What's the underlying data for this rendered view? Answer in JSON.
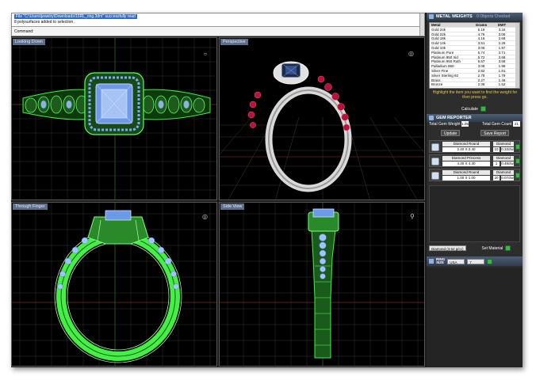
{
  "command": {
    "line1": "File \"C:\\Users\\jewelry\\Downloads\\16RL_ring.3dm\" successfully read",
    "line2": "8 polysurfaces added to selection.",
    "prompt": "Command:"
  },
  "viewports": {
    "top_left": "Looking Down",
    "top_right": "Perspective",
    "bottom_left": "Through Finger",
    "bottom_right": "Side View"
  },
  "metal_weights": {
    "title": "METAL WEIGHTS",
    "subtitle": "0 Objects Checked",
    "headers": [
      "Metal",
      "Grams",
      "DWT"
    ],
    "rows": [
      [
        "Gold 24k",
        "5.19",
        "3.34"
      ],
      [
        "Gold 22k",
        "4.76",
        "3.06"
      ],
      [
        "Gold 18k",
        "4.16",
        "2.68"
      ],
      [
        "Gold 14k",
        "3.51",
        "2.26"
      ],
      [
        "Gold 10k",
        "3.06",
        "1.97"
      ],
      [
        "Platinum Pure",
        "5.74",
        "3.71"
      ],
      [
        "Platinum 950 Irid",
        "5.72",
        "3.68"
      ],
      [
        "Platinum 950 Ruth",
        "5.57",
        "3.58"
      ],
      [
        "Palladium 950",
        "3.08",
        "1.98"
      ],
      [
        "Silver Fine",
        "2.82",
        "1.81"
      ],
      [
        "Silver Sterling 92",
        "2.78",
        "1.79"
      ],
      [
        "Brass",
        "2.27",
        "1.46"
      ],
      [
        "Bronze",
        "2.36",
        "1.52"
      ]
    ],
    "hint": "Highlight the item you want to find the weight for then press go.",
    "calculate": "Calculate"
  },
  "gem_reporter": {
    "title": "GEM REPORTER",
    "total_weight_label": "Total Gem Weight",
    "total_weight_value": "1.05",
    "total_count_label": "Total Gem Count",
    "total_count_value": "21",
    "update": "Update",
    "save_report": "Save Report",
    "gems": [
      {
        "name": "Diamond Round",
        "type": "Diamond",
        "size": "2.40 X 2.40",
        "count": "10",
        "weight": "0.32ctw"
      },
      {
        "name": "Diamond Princess",
        "type": "Diamond",
        "size": "4.30 X 4.30",
        "count": "1",
        "weight": "0.48ctw"
      },
      {
        "name": "Diamond Round",
        "type": "Diamond",
        "size": "1.00 X 1.00",
        "count": "20",
        "weight": "0.07ctw"
      }
    ],
    "material_select": "Diamond (3.52 g/cc)",
    "set_material": "Set Material"
  },
  "ring_size": {
    "label_line1": "RING",
    "label_line2": "SIZE",
    "standard": "USA",
    "size": "7"
  },
  "colors": {
    "wire_green": "#44f044",
    "wire_blue": "#8fb8ff",
    "ruby": "#b8123c",
    "grid": "#3a3a3a",
    "panel_bg": "#2d2d2d",
    "button_green": "#3bb54a"
  }
}
